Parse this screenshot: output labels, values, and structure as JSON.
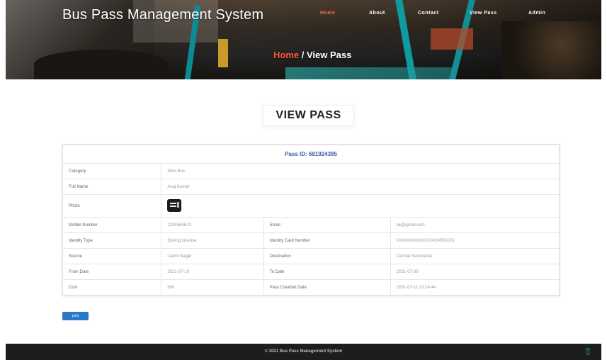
{
  "header": {
    "brand": "Bus Pass Management System",
    "nav": [
      {
        "label": "Home",
        "active": true
      },
      {
        "label": "About",
        "active": false
      },
      {
        "label": "Contact",
        "active": false
      },
      {
        "label": "View Pass",
        "active": false
      },
      {
        "label": "Admin",
        "active": false
      }
    ],
    "breadcrumb": {
      "home": "Home",
      "separator": " / ",
      "current": "View Pass"
    }
  },
  "page": {
    "title": "VIEW PASS"
  },
  "pass": {
    "pass_id_label": "Pass ID: 681924385",
    "category_label": "Category",
    "category": "Dtmt Bus",
    "full_name_label": "Full Name",
    "full_name": "Anuj Kumar",
    "photo_label": "Photo",
    "mobile_label": "Mobile Number",
    "mobile": "1234564673",
    "email_label": "Email",
    "email": "ak@gmail.com",
    "identity_type_label": "Identity Type",
    "identity_type": "Driving License",
    "identity_card_label": "Identity Card Number",
    "identity_card": "XXXXXXXXXXXXXX345XXXX",
    "source_label": "Source",
    "source": "Laxmi Nagar",
    "destination_label": "Destination",
    "destination": "Central Secretariat",
    "from_date_label": "From Date",
    "from_date": "2021-07-10",
    "to_date_label": "To Date",
    "to_date": "2021-07-30",
    "cost_label": "Cost",
    "cost": "500",
    "creation_label": "Pass Creation Date",
    "creation": "2021-07-11 13:24:44"
  },
  "actions": {
    "print_label": "print"
  },
  "footer": {
    "text": "© 2021 Bus Pass Management System"
  },
  "colors": {
    "accent": "#ff6a4a",
    "teal": "#19b6a6",
    "link_blue": "#3c5aa8",
    "button": "#2a78c8"
  }
}
